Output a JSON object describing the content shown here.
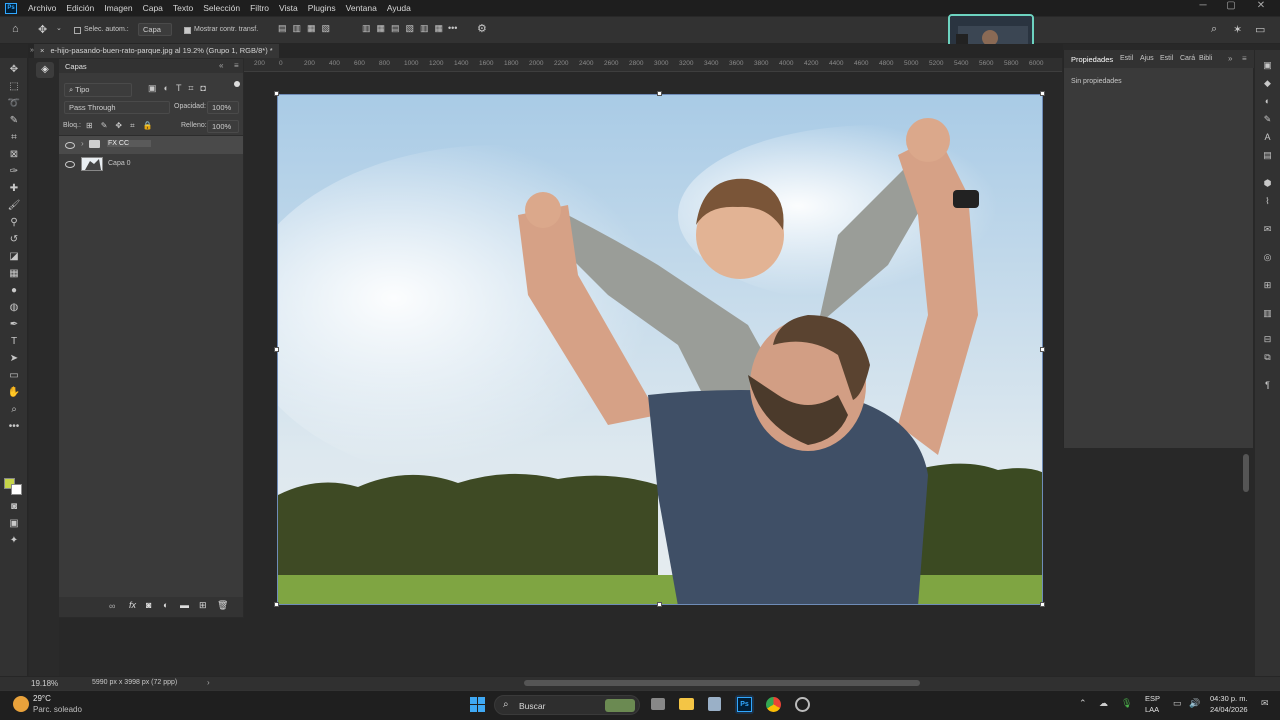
{
  "menubar": {
    "logo": "Ps",
    "items": [
      "Archivo",
      "Edición",
      "Imagen",
      "Capa",
      "Texto",
      "Selección",
      "Filtro",
      "Vista",
      "Plugins",
      "Ventana",
      "Ayuda"
    ]
  },
  "options": {
    "auto_select_label": "Selec. autom.:",
    "auto_select_value": "Capa",
    "show_transform_label": "Mostrar contr. transf.",
    "more_label": "•••"
  },
  "document_tab": {
    "title": "e-hijo-pasando-buen-rato-parque.jpg al 19.2% (Grupo 1, RGB/8*) *"
  },
  "layers_panel": {
    "tab": "Capas",
    "filter_label": "Tipo",
    "blend_mode": "Pass Through",
    "opacity_label": "Opacidad:",
    "opacity_value": "100%",
    "lock_label": "Bloq.:",
    "fill_label": "Relleno:",
    "fill_value": "100%",
    "layers": [
      {
        "name": "FX CC",
        "type": "group"
      },
      {
        "name": "Capa 0",
        "type": "image"
      }
    ]
  },
  "ruler": {
    "ticks": [
      "200",
      "0",
      "200",
      "400",
      "600",
      "800",
      "1000",
      "1200",
      "1400",
      "1600",
      "1800",
      "2000",
      "2200",
      "2400",
      "2600",
      "2800",
      "3000",
      "3200",
      "3400",
      "3600",
      "3800",
      "4000",
      "4200",
      "4400",
      "4600",
      "4800",
      "5000",
      "5200",
      "5400",
      "5600",
      "5800",
      "6000"
    ]
  },
  "properties_panel": {
    "tabs": [
      "Propiedades",
      "Estil",
      "Ajus",
      "Estil",
      "Cará",
      "Bibli"
    ],
    "content": "Sin propiedades"
  },
  "status": {
    "zoom": "19.18%",
    "dimensions": "5990 px x 3998 px (72 ppp)"
  },
  "taskbar": {
    "weather_temp": "29°C",
    "weather_desc": "Parc. soleado",
    "search_label": "Buscar",
    "lang_top": "ESP",
    "lang_bottom": "LAA",
    "time": "04:30 p. m.",
    "date": "24/04/2026"
  },
  "colors": {
    "accent": "#31a8ff",
    "foreground_swatch": "#c7d64a",
    "background_swatch": "#ffffff"
  }
}
